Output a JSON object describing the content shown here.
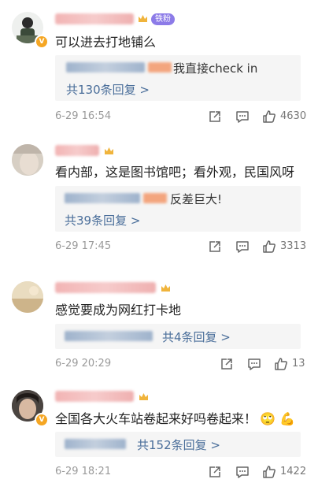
{
  "comments": [
    {
      "text": "可以进去打地铺么",
      "fan_badge": "铁粉",
      "reply_preview": "我直接check in",
      "reply_more": "共130条回复 >",
      "time": "6-29 16:54",
      "likes": "4630",
      "verified": "V"
    },
    {
      "text": "看内部，这是图书馆吧；看外观，民国风呀",
      "reply_preview": "反差巨大!",
      "reply_more": "共39条回复 >",
      "time": "6-29 17:45",
      "likes": "3313"
    },
    {
      "text": "感觉要成为网红打卡地",
      "reply_more": "共4条回复 >",
      "time": "6-29 20:29",
      "likes": "13"
    },
    {
      "text": "全国各大火车站卷起来好吗卷起来！",
      "emoji": "🙄 💪",
      "reply_more": "共152条回复 >",
      "time": "6-29 18:21",
      "likes": "1422",
      "verified": "V"
    }
  ],
  "icons": {
    "share": "share-icon",
    "comment": "comment-icon",
    "like": "like-icon",
    "crown": "crown-icon"
  }
}
